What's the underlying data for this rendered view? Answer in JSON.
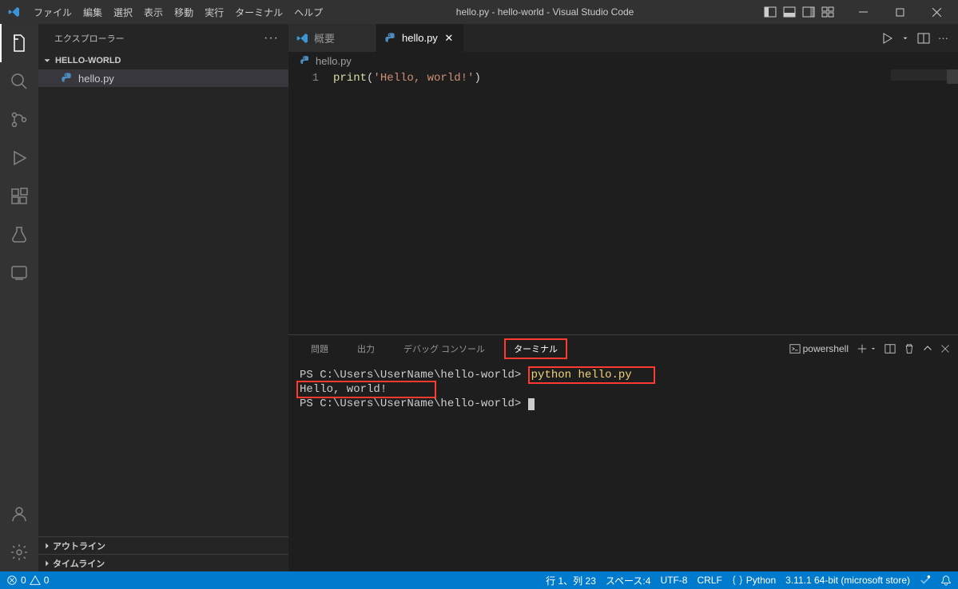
{
  "titlebar": {
    "menus": [
      "ファイル",
      "編集",
      "選択",
      "表示",
      "移動",
      "実行",
      "ターミナル",
      "ヘルプ"
    ],
    "title": "hello.py - hello-world - Visual Studio Code"
  },
  "sidebar": {
    "title": "エクスプローラー",
    "project": "HELLO-WORLD",
    "files": [
      {
        "name": "hello.py",
        "icon": "python"
      }
    ],
    "collapsed_sections": [
      "アウトライン",
      "タイムライン"
    ]
  },
  "tabs": [
    {
      "icon": "vscode",
      "label": "概要",
      "active": false
    },
    {
      "icon": "python",
      "label": "hello.py",
      "active": true
    }
  ],
  "breadcrumb": {
    "icon": "python",
    "label": "hello.py"
  },
  "code": {
    "line_number": "1",
    "fn": "print",
    "paren_open": "(",
    "string": "'Hello, world!'",
    "paren_close": ")"
  },
  "panel": {
    "tabs": [
      "問題",
      "出力",
      "デバッグ コンソール",
      "ターミナル"
    ],
    "active_index": 3,
    "shell_label": "powershell",
    "terminal": {
      "prompt1": "PS C:\\Users\\UserName\\hello-world>",
      "command": "python hello.py",
      "output": "Hello, world!",
      "prompt2": "PS C:\\Users\\UserName\\hello-world>"
    }
  },
  "statusbar": {
    "errors": "0",
    "warnings": "0",
    "line_col": "行 1、列 23",
    "spaces": "スペース:4",
    "encoding": "UTF-8",
    "eol": "CRLF",
    "language": "Python",
    "python_version": "3.11.1 64-bit (microsoft store)"
  }
}
